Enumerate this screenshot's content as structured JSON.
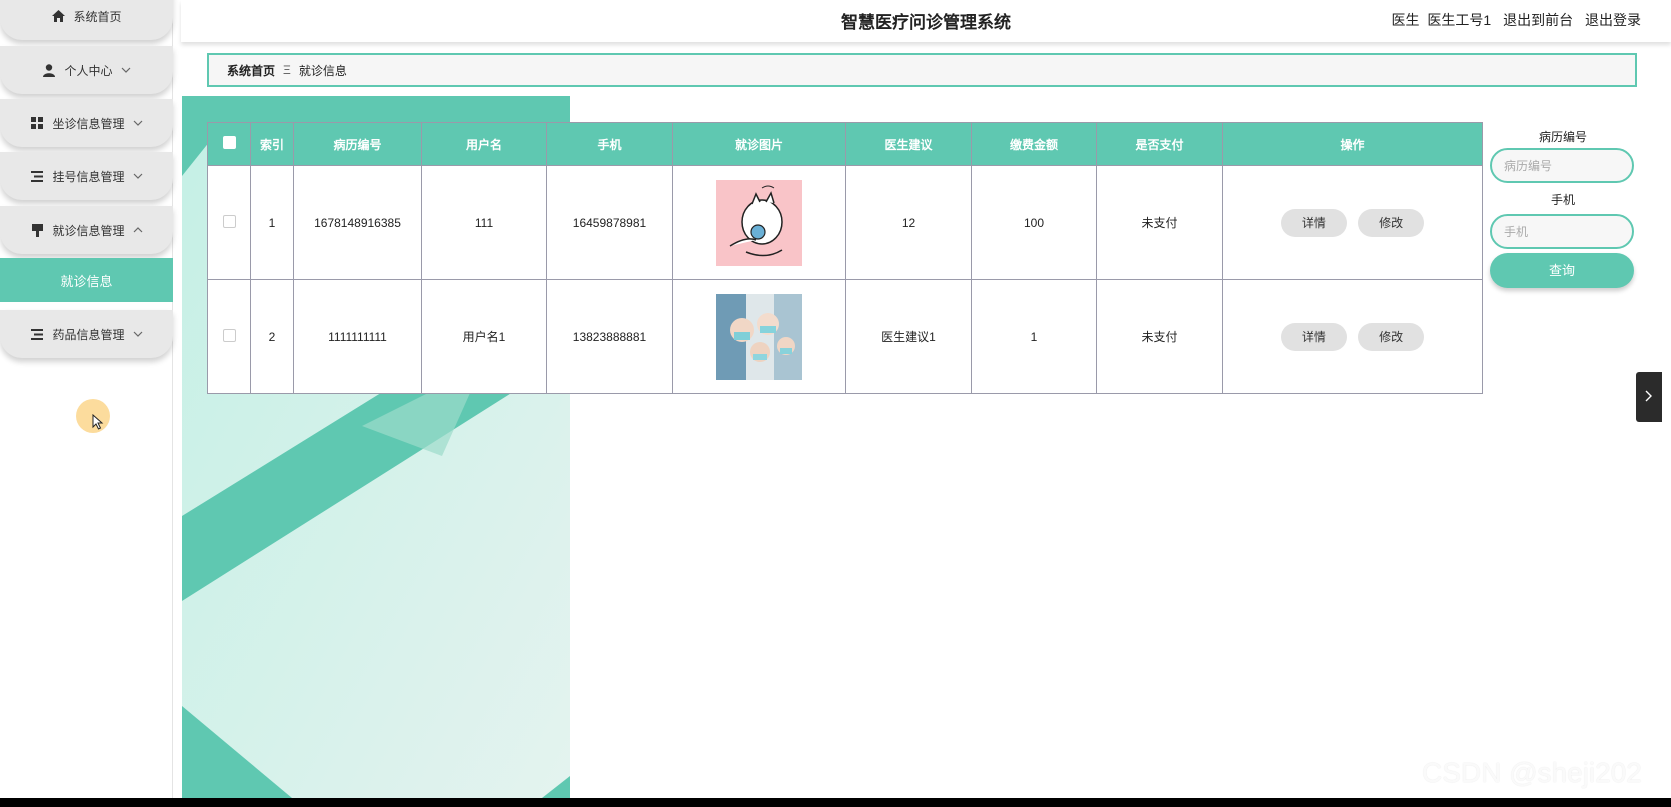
{
  "sidebar": {
    "items": [
      {
        "label": "系统首页",
        "icon": "home-icon",
        "has_children": false
      },
      {
        "label": "个人中心",
        "icon": "user-icon",
        "has_children": true
      },
      {
        "label": "坐诊信息管理",
        "icon": "grid-icon",
        "has_children": true
      },
      {
        "label": "挂号信息管理",
        "icon": "list-icon",
        "has_children": true
      },
      {
        "label": "就诊信息管理",
        "icon": "flag-icon",
        "has_children": true,
        "expanded": true
      },
      {
        "label": "药品信息管理",
        "icon": "list-icon",
        "has_children": true
      }
    ],
    "active_submenu": "就诊信息"
  },
  "header": {
    "title": "智慧医疗问诊管理系统",
    "role": "医生",
    "username": "医生工号1",
    "to_front": "退出到前台",
    "logout": "退出登录"
  },
  "breadcrumb": {
    "home": "系统首页",
    "separator": "Ξ",
    "current": "就诊信息"
  },
  "table": {
    "columns": [
      "索引",
      "病历编号",
      "用户名",
      "手机",
      "就诊图片",
      "医生建议",
      "缴费金额",
      "是否支付",
      "操作"
    ],
    "rows": [
      {
        "index": "1",
        "record_no": "1678148916385",
        "username": "111",
        "phone": "16459878981",
        "image": "cat-sticker-image",
        "advice": "12",
        "amount": "100",
        "paid": "未支付"
      },
      {
        "index": "2",
        "record_no": "1111111111",
        "username": "用户名1",
        "phone": "13823888881",
        "image": "medical-team-photo",
        "advice": "医生建议1",
        "amount": "1",
        "paid": "未支付"
      }
    ],
    "detail_label": "详情",
    "edit_label": "修改"
  },
  "search": {
    "record_label": "病历编号",
    "record_placeholder": "病历编号",
    "phone_label": "手机",
    "phone_placeholder": "手机",
    "button_label": "查询"
  },
  "colors": {
    "accent": "#5fc8b1",
    "menu_bg": "#e8e8e8"
  },
  "watermark": "CSDN @sheji202"
}
